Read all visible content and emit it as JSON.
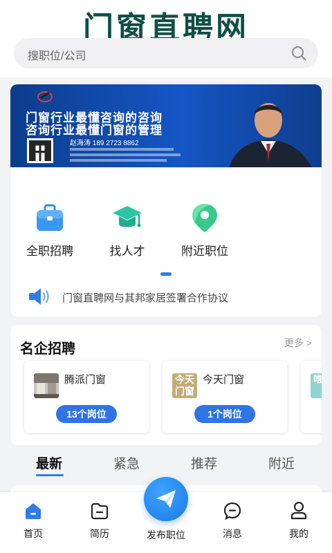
{
  "header": {
    "logo_text": "门窗直聘网"
  },
  "search": {
    "placeholder": "搜职位/公司"
  },
  "banner": {
    "line1": "门窗行业最懂咨询的咨询",
    "line2": "咨询行业最懂门窗的管理",
    "contact": "赵海涛  189 2723 8862"
  },
  "quick_icons": [
    {
      "label": "全职招聘",
      "icon": "briefcase-icon"
    },
    {
      "label": "找人才",
      "icon": "graduation-cap-icon"
    },
    {
      "label": "附近职位",
      "icon": "location-pin-icon"
    }
  ],
  "news": {
    "text": "门窗直聘网与其邦家居签署合作协议",
    "icon": "speaker-icon"
  },
  "famous_companies": {
    "title": "名企招聘",
    "more": "更多 >",
    "items": [
      {
        "name": "腾派门窗",
        "jobs": "13个岗位"
      },
      {
        "name": "今天门窗",
        "jobs": "1个岗位",
        "logo_text": "今天门窗"
      },
      {
        "name": "",
        "jobs": "",
        "logo_text": "唯宅"
      }
    ]
  },
  "tabs": [
    {
      "label": "最新",
      "active": true
    },
    {
      "label": "紧急",
      "active": false
    },
    {
      "label": "推荐",
      "active": false
    },
    {
      "label": "附近",
      "active": false
    }
  ],
  "bottom_nav": [
    {
      "label": "首页",
      "icon": "home-icon",
      "active": true
    },
    {
      "label": "简历",
      "icon": "resume-folder-icon"
    },
    {
      "label": "发布职位",
      "icon": "paper-plane-icon"
    },
    {
      "label": "消息",
      "icon": "message-bubble-icon"
    },
    {
      "label": "我的",
      "icon": "user-icon"
    }
  ],
  "colors": {
    "brand": "#0f4f45",
    "accent": "#2f7be8",
    "pill": "#2f74e4"
  }
}
